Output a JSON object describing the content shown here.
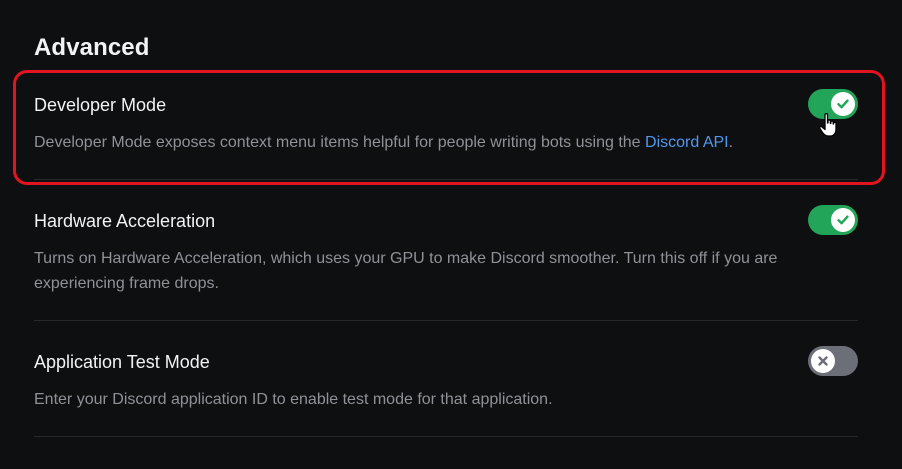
{
  "section": {
    "title": "Advanced"
  },
  "settings": [
    {
      "title": "Developer Mode",
      "description": "Developer Mode exposes context menu items helpful for people writing bots using the ",
      "link_text": "Discord API",
      "description_suffix": ".",
      "enabled": true
    },
    {
      "title": "Hardware Acceleration",
      "description": "Turns on Hardware Acceleration, which uses your GPU to make Discord smoother. Turn this off if you are experiencing frame drops.",
      "enabled": true
    },
    {
      "title": "Application Test Mode",
      "description": "Enter your Discord application ID to enable test mode for that application.",
      "enabled": false
    }
  ],
  "colors": {
    "toggle_on": "#23a559",
    "toggle_off": "#6d6f78",
    "link": "#5197ed",
    "highlight": "#e3131f"
  },
  "icons": {
    "on_knob": "check-icon",
    "off_knob": "x-icon",
    "pointer": "hand-cursor-icon"
  }
}
